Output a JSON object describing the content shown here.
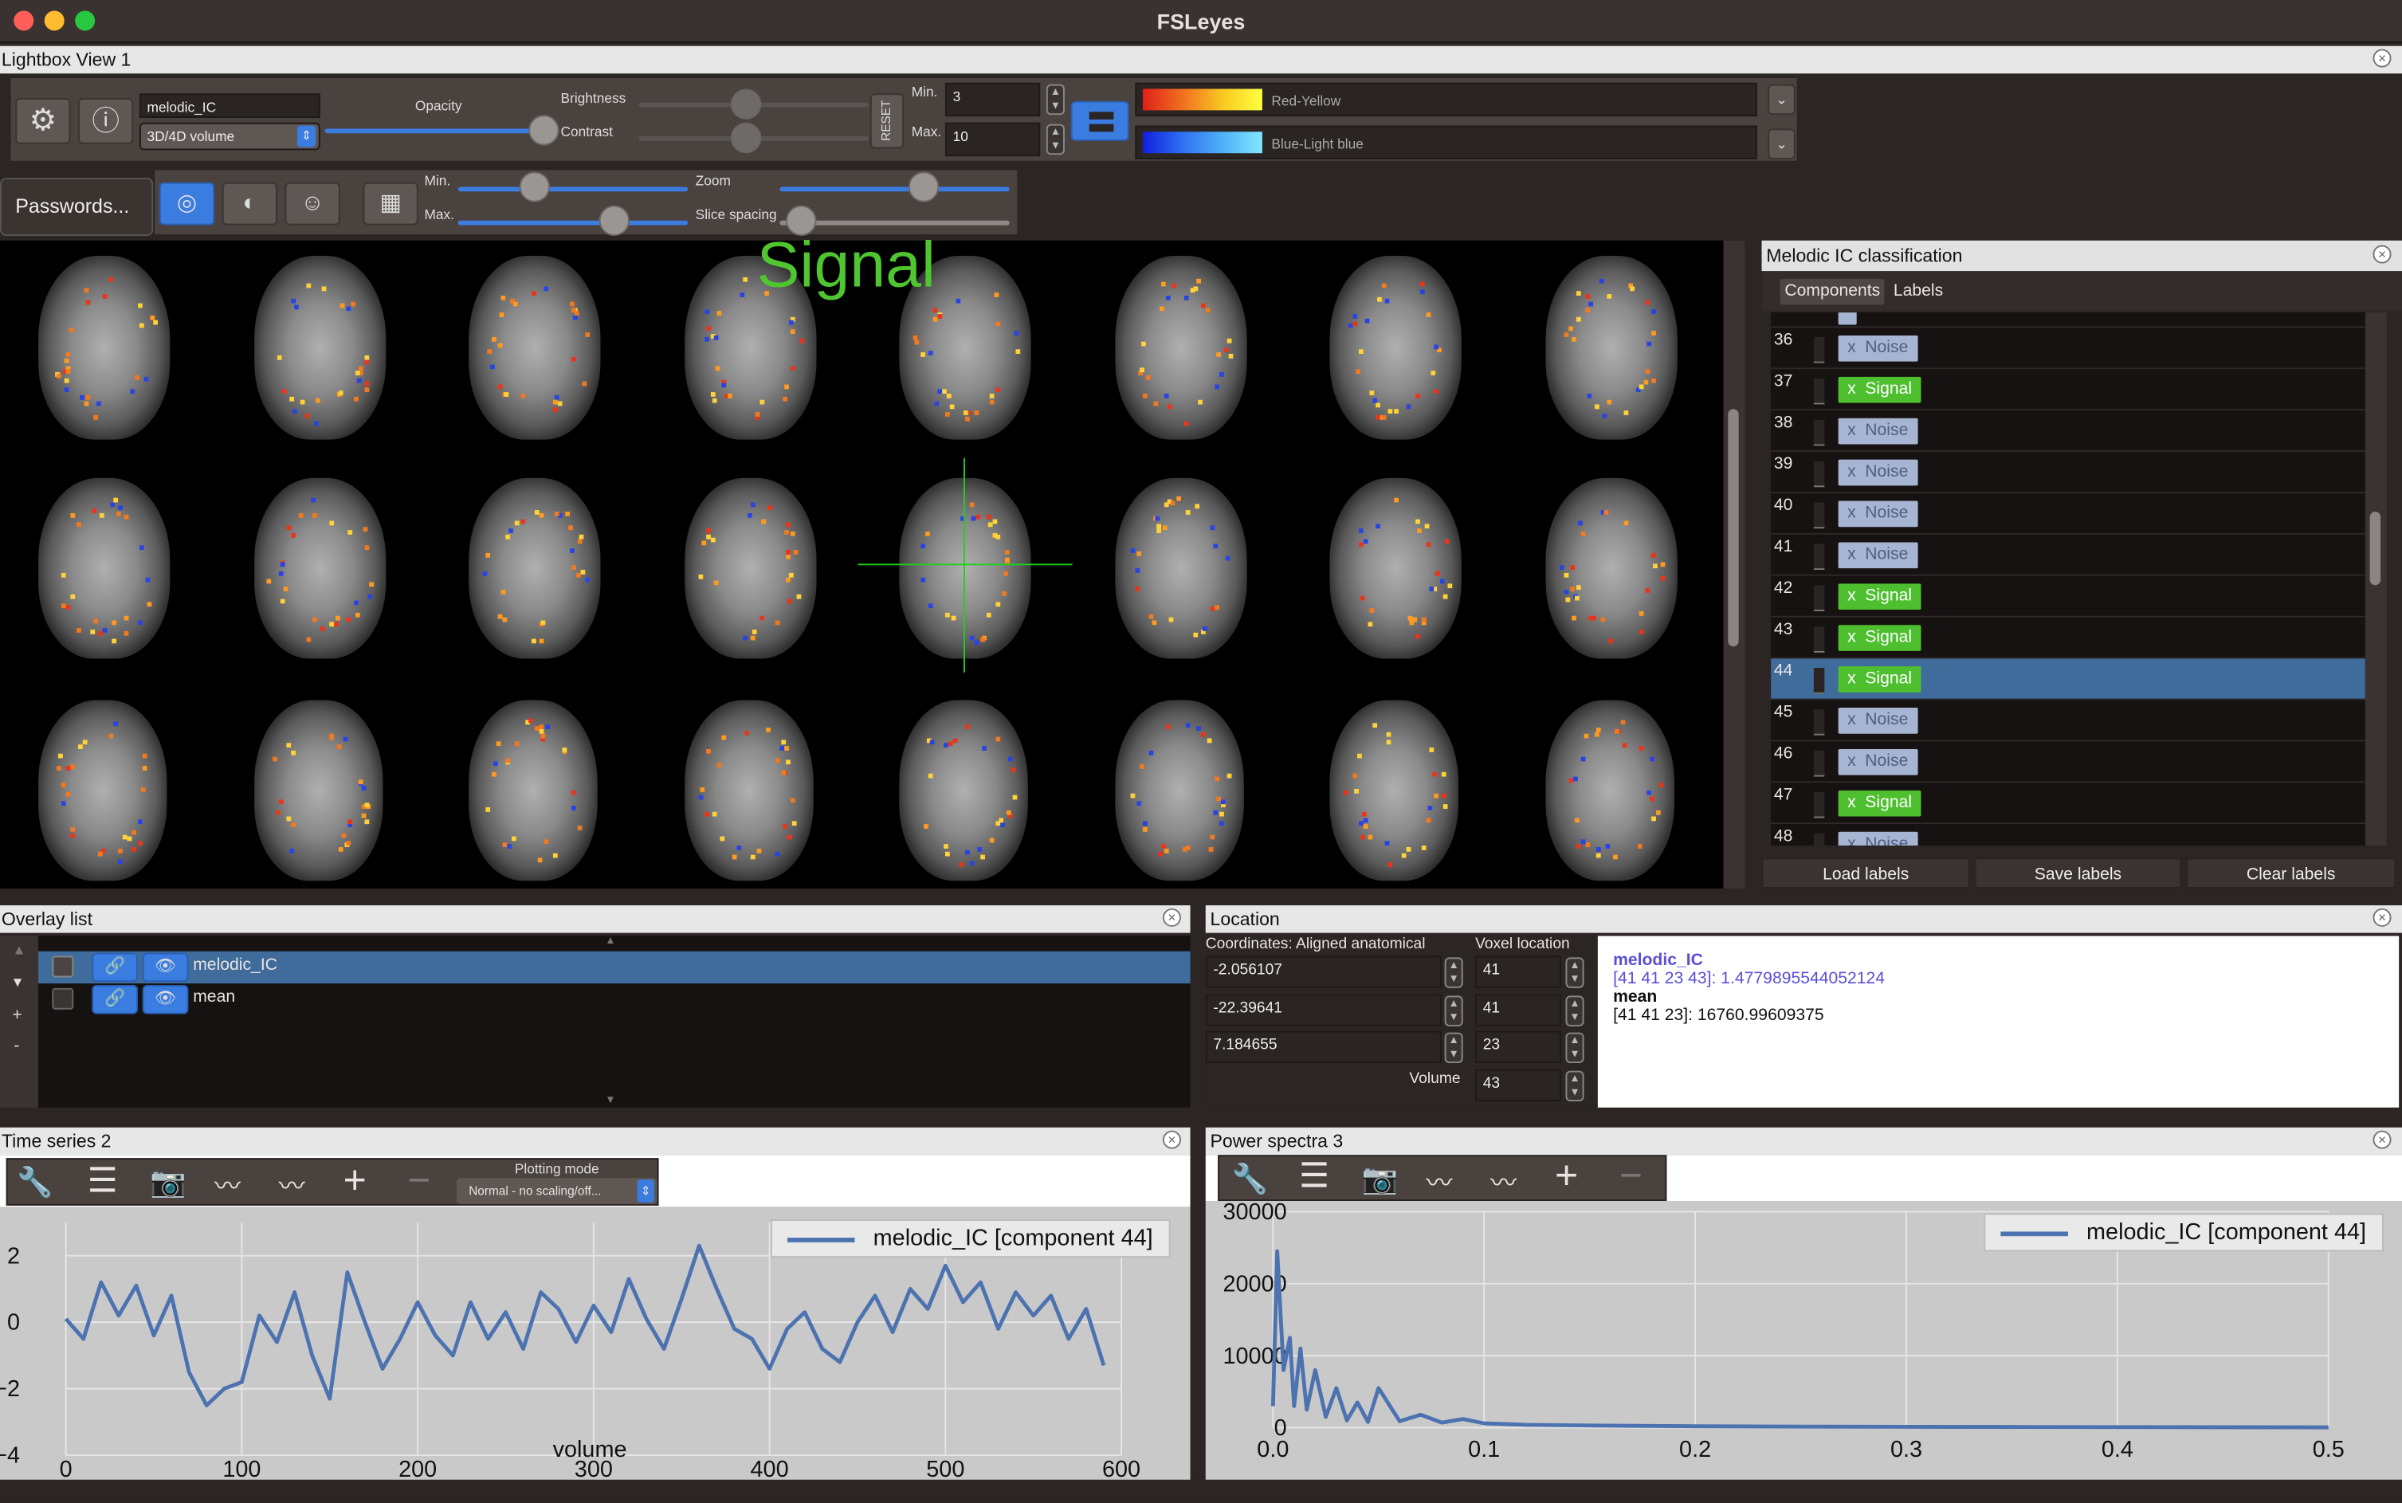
{
  "app": {
    "title": "FSLeyes"
  },
  "lightbox": {
    "title": "Lightbox View 1",
    "overlay_name": "melodic_IC",
    "volume_type": "3D/4D volume",
    "labels": {
      "opacity": "Opacity",
      "brightness": "Brightness",
      "contrast": "Contrast",
      "reset": "RESET",
      "min": "Min.",
      "max": "Max.",
      "zoom": "Zoom",
      "slice_spacing": "Slice spacing"
    },
    "min_value": "3",
    "max_value": "10",
    "cmap1": "Red-Yellow",
    "cmap2": "Blue-Light blue",
    "passwords_label": "Passwords...",
    "overlay_label": "Signal"
  },
  "classification": {
    "title": "Melodic IC classification",
    "tabs": [
      "Components",
      "Labels"
    ],
    "rows": [
      {
        "id": "36",
        "label": "Noise"
      },
      {
        "id": "37",
        "label": "Signal"
      },
      {
        "id": "38",
        "label": "Noise"
      },
      {
        "id": "39",
        "label": "Noise"
      },
      {
        "id": "40",
        "label": "Noise"
      },
      {
        "id": "41",
        "label": "Noise"
      },
      {
        "id": "42",
        "label": "Signal"
      },
      {
        "id": "43",
        "label": "Signal"
      },
      {
        "id": "44",
        "label": "Signal"
      },
      {
        "id": "45",
        "label": "Noise"
      },
      {
        "id": "46",
        "label": "Noise"
      },
      {
        "id": "47",
        "label": "Signal"
      },
      {
        "id": "48",
        "label": "Noise"
      }
    ],
    "selected": "44",
    "remove_glyph": "x",
    "buttons": {
      "load": "Load labels",
      "save": "Save labels",
      "clear": "Clear labels"
    }
  },
  "overlay_list": {
    "title": "Overlay list",
    "items": [
      "melodic_IC",
      "mean"
    ],
    "side_buttons": [
      "▲",
      "▼",
      "+",
      "-"
    ]
  },
  "location": {
    "title": "Location",
    "coord_header": "Coordinates: Aligned anatomical",
    "voxel_header": "Voxel location",
    "coords": [
      "-2.056107",
      "-22.39641",
      "7.184655"
    ],
    "voxels": [
      "41",
      "41",
      "23"
    ],
    "volume_label": "Volume",
    "volume_value": "43",
    "info": {
      "name1": "melodic_IC",
      "line1": "[41 41 23 43]: 1.4779895544052124",
      "name2": "mean",
      "line2": "[41 41 23]: 16760.99609375"
    }
  },
  "timeseries": {
    "title": "Time series 2",
    "plotting_mode_label": "Plotting mode",
    "plotting_mode": "Normal - no scaling/off...",
    "legend": "melodic_IC [component 44]",
    "xlabel": "volume",
    "xticks": [
      "0",
      "100",
      "200",
      "300",
      "400",
      "500",
      "600"
    ],
    "yticks": [
      "2",
      "0",
      "−2",
      "−4"
    ]
  },
  "powerspectra": {
    "title": "Power spectra 3",
    "legend": "melodic_IC [component 44]",
    "xticks": [
      "0.0",
      "0.1",
      "0.2",
      "0.3",
      "0.4",
      "0.5"
    ],
    "yticks": [
      "30000",
      "20000",
      "10000",
      "0"
    ]
  },
  "chart_data": [
    {
      "type": "line",
      "title": "",
      "xlabel": "volume",
      "ylabel": "",
      "xlim": [
        0,
        600
      ],
      "ylim": [
        -4,
        3
      ],
      "grid": true,
      "legend": "top-right",
      "series": [
        {
          "name": "melodic_IC [component 44]",
          "color": "#4c72b0",
          "x": [
            0,
            10,
            20,
            30,
            40,
            50,
            60,
            70,
            80,
            90,
            100,
            110,
            120,
            130,
            140,
            150,
            160,
            170,
            180,
            190,
            200,
            210,
            220,
            230,
            240,
            250,
            260,
            270,
            280,
            290,
            300,
            310,
            320,
            330,
            340,
            350,
            360,
            370,
            380,
            390,
            400,
            410,
            420,
            430,
            440,
            450,
            460,
            470,
            480,
            490,
            500,
            510,
            520,
            530,
            540,
            550,
            560,
            570,
            580,
            590
          ],
          "y": [
            0.1,
            -0.5,
            1.2,
            0.2,
            1.1,
            -0.4,
            0.8,
            -1.5,
            -2.5,
            -2.0,
            -1.8,
            0.2,
            -0.6,
            0.9,
            -1.0,
            -2.3,
            1.5,
            0.0,
            -1.4,
            -0.5,
            0.6,
            -0.4,
            -1.0,
            0.6,
            -0.5,
            0.3,
            -0.8,
            0.9,
            0.4,
            -0.6,
            0.5,
            -0.3,
            1.3,
            0.1,
            -0.8,
            0.7,
            2.3,
            1.0,
            -0.2,
            -0.5,
            -1.4,
            -0.2,
            0.3,
            -0.8,
            -1.2,
            0.0,
            0.8,
            -0.3,
            1.0,
            0.4,
            1.7,
            0.6,
            1.2,
            -0.2,
            0.9,
            0.2,
            0.8,
            -0.5,
            0.4,
            -1.3
          ]
        }
      ]
    },
    {
      "type": "line",
      "title": "",
      "xlabel": "",
      "ylabel": "",
      "xlim": [
        0,
        0.5
      ],
      "ylim": [
        0,
        30000
      ],
      "grid": true,
      "legend": "top-right",
      "series": [
        {
          "name": "melodic_IC [component 44]",
          "color": "#4c72b0",
          "x": [
            0.0,
            0.002,
            0.005,
            0.008,
            0.01,
            0.013,
            0.016,
            0.02,
            0.025,
            0.03,
            0.035,
            0.04,
            0.045,
            0.05,
            0.06,
            0.07,
            0.08,
            0.09,
            0.1,
            0.12,
            0.15,
            0.2,
            0.25,
            0.3,
            0.35,
            0.4,
            0.45,
            0.5
          ],
          "y": [
            3000,
            24500,
            8000,
            12500,
            3000,
            11000,
            2500,
            8000,
            1500,
            5500,
            1000,
            3500,
            800,
            5500,
            900,
            1800,
            700,
            1200,
            600,
            400,
            300,
            200,
            150,
            120,
            100,
            80,
            60,
            50
          ]
        }
      ]
    }
  ]
}
